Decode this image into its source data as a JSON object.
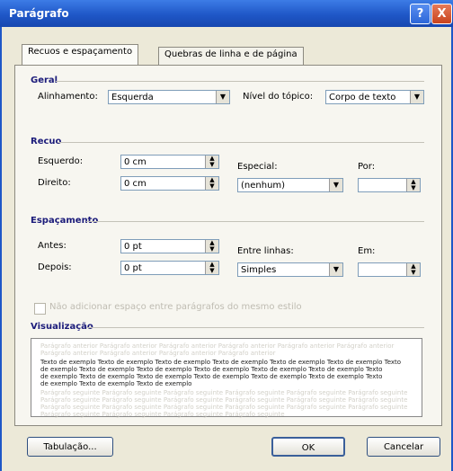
{
  "window": {
    "title": "Parágrafo",
    "help": "?",
    "close": "X"
  },
  "tabs": [
    {
      "label": "Recuos e espaçamento",
      "active": true
    },
    {
      "label": "Quebras de linha e de página",
      "active": false
    }
  ],
  "general": {
    "section": "Geral",
    "alignment_label": "Alinhamento:",
    "alignment_value": "Esquerda",
    "outline_label": "Nível do tópico:",
    "outline_value": "Corpo de texto"
  },
  "indent": {
    "section": "Recuo",
    "left_label": "Esquerdo:",
    "left_value": "0 cm",
    "right_label": "Direito:",
    "right_value": "0 cm",
    "special_label": "Especial:",
    "special_value": "(nenhum)",
    "by_label": "Por:",
    "by_value": ""
  },
  "spacing": {
    "section": "Espaçamento",
    "before_label": "Antes:",
    "before_value": "0 pt",
    "after_label": "Depois:",
    "after_value": "0 pt",
    "line_label": "Entre linhas:",
    "line_value": "Simples",
    "at_label": "Em:",
    "at_value": ""
  },
  "checkbox_text": "Não adicionar espaço entre parágrafos do mesmo estilo",
  "preview": {
    "section": "Visualização",
    "lines": [
      "Parágrafo anterior Parágrafo anterior Parágrafo anterior Parágrafo anterior Parágrafo anterior Parágrafo anterior",
      "Parágrafo anterior Parágrafo anterior Parágrafo anterior Parágrafo anterior",
      "Texto de exemplo  Texto de exemplo  Texto de exemplo  Texto de exemplo  Texto de exemplo  Texto de exemplo  Texto",
      "de exemplo  Texto de exemplo  Texto de exemplo  Texto de exemplo  Texto de exemplo  Texto de exemplo  Texto",
      "de exemplo  Texto de exemplo  Texto de exemplo  Texto de exemplo  Texto de exemplo  Texto de exemplo  Texto",
      "de exemplo  Texto de exemplo  Texto de exemplo",
      "Parágrafo seguinte Parágrafo seguinte Parágrafo seguinte Parágrafo seguinte Parágrafo seguinte Parágrafo seguinte",
      "Parágrafo seguinte Parágrafo seguinte Parágrafo seguinte Parágrafo seguinte Parágrafo seguinte Parágrafo seguinte",
      "Parágrafo seguinte Parágrafo seguinte Parágrafo seguinte Parágrafo seguinte Parágrafo seguinte Parágrafo seguinte",
      "Parágrafo seguinte Parágrafo seguinte Parágrafo seguinte Parágrafo seguinte"
    ]
  },
  "buttons": {
    "tabs": "Tabulação...",
    "ok": "OK",
    "cancel": "Cancelar"
  },
  "icons": {
    "dropdown": "▼",
    "spin_up": "▲",
    "spin_down": "▼"
  }
}
